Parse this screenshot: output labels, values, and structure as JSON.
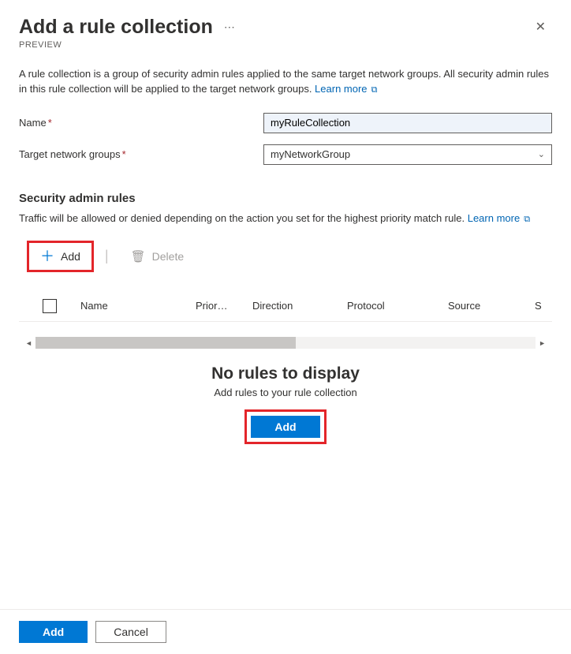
{
  "header": {
    "title": "Add a rule collection",
    "preview": "PREVIEW"
  },
  "description": {
    "text": "A rule collection is a group of security admin rules applied to the same target network groups. All security admin rules in this rule collection will be applied to the target network groups. ",
    "learn_more": "Learn more"
  },
  "form": {
    "name_label": "Name",
    "name_value": "myRuleCollection",
    "target_label": "Target network groups",
    "target_value": "myNetworkGroup"
  },
  "rules_section": {
    "title": "Security admin rules",
    "desc_text": "Traffic will be allowed or denied depending on the action you set for the highest priority match rule. ",
    "learn_more": "Learn more"
  },
  "toolbar": {
    "add_label": "Add",
    "delete_label": "Delete"
  },
  "table": {
    "columns": {
      "name": "Name",
      "priority": "Prior…",
      "direction": "Direction",
      "protocol": "Protocol",
      "source": "Source",
      "source_port_truncated": "S"
    }
  },
  "empty": {
    "title": "No rules to display",
    "subtitle": "Add rules to your rule collection",
    "button": "Add"
  },
  "footer": {
    "add": "Add",
    "cancel": "Cancel"
  }
}
